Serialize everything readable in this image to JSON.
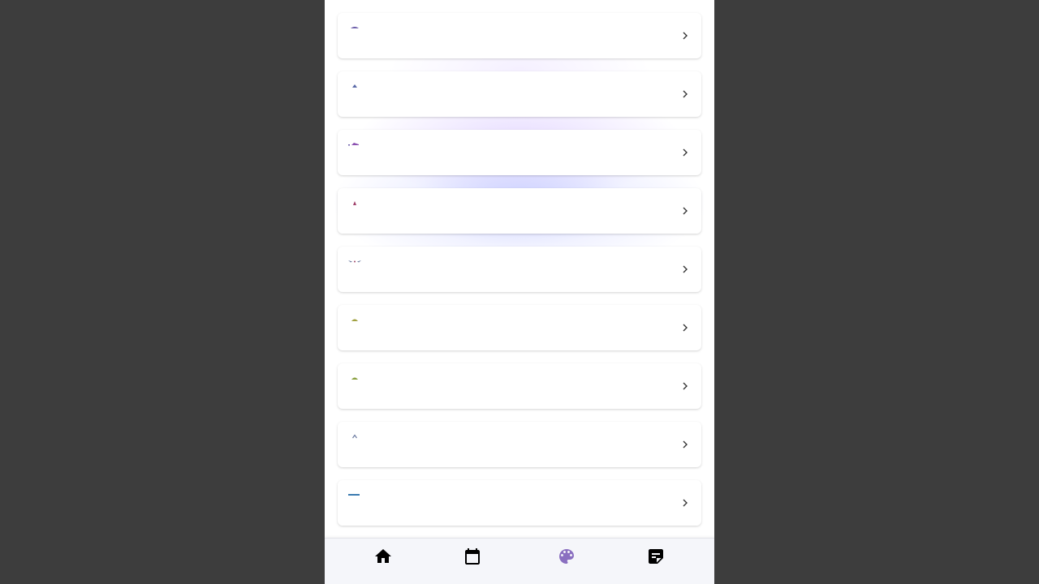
{
  "items": [
    {
      "thumb": "umbrella-icon",
      "color": "#6a5ba8"
    },
    {
      "thumb": "triangle-icon",
      "color": "#5a6aa8"
    },
    {
      "thumb": "flag-icon",
      "color": "#8a4fb0"
    },
    {
      "thumb": "triangle-icon",
      "color": "#a0406a"
    },
    {
      "thumb": "wings-icon",
      "color": "#6a7aa0"
    },
    {
      "thumb": "dome-icon",
      "color": "#a0a040"
    },
    {
      "thumb": "dome-icon",
      "color": "#8aa040"
    },
    {
      "thumb": "caret-icon",
      "color": "#6a7aa0"
    },
    {
      "thumb": "bar-icon",
      "color": "#3a7ab0"
    }
  ],
  "nav": [
    {
      "icon": "home-icon",
      "active": false
    },
    {
      "icon": "calendar-icon",
      "active": false
    },
    {
      "icon": "palette-icon",
      "active": true,
      "color": "#8a6fc0"
    },
    {
      "icon": "note-icon",
      "active": false
    }
  ]
}
